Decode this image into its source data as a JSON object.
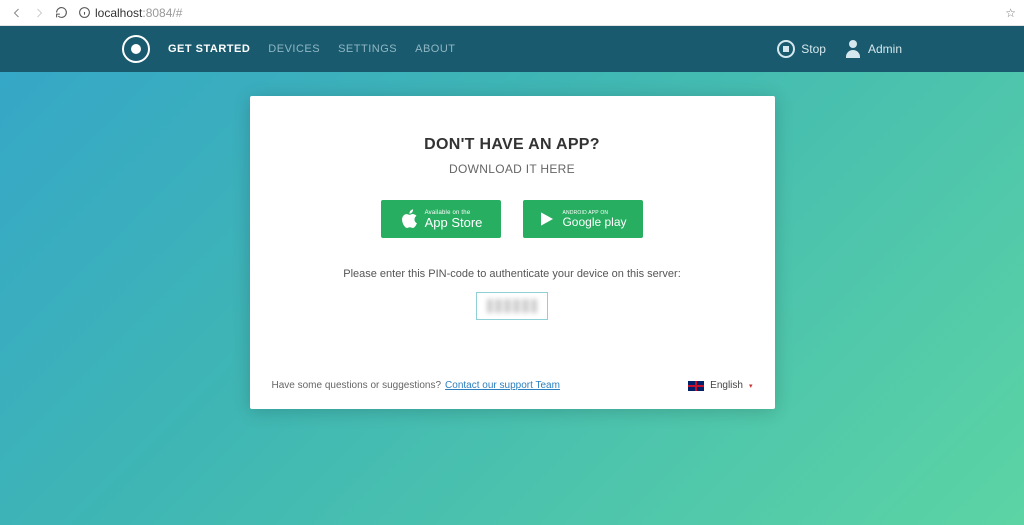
{
  "chrome": {
    "url_host": "localhost",
    "url_port": ":8084/#"
  },
  "nav": {
    "items": [
      {
        "label": "GET STARTED",
        "active": true
      },
      {
        "label": "DEVICES",
        "active": false
      },
      {
        "label": "SETTINGS",
        "active": false
      },
      {
        "label": "ABOUT",
        "active": false
      }
    ],
    "stop_label": "Stop",
    "admin_label": "Admin"
  },
  "card": {
    "heading": "DON'T HAVE AN APP?",
    "subheading": "DOWNLOAD IT HERE",
    "appstore": {
      "line1": "Available on the",
      "line2": "App Store"
    },
    "googleplay": {
      "line1": "ANDROID APP ON",
      "line2": "Google play"
    },
    "pin_instruction": "Please enter this PIN-code to authenticate your device on this server:",
    "footer_question": "Have some questions or suggestions?",
    "support_link": "Contact our support Team",
    "language_label": "English",
    "caret": "▾"
  }
}
